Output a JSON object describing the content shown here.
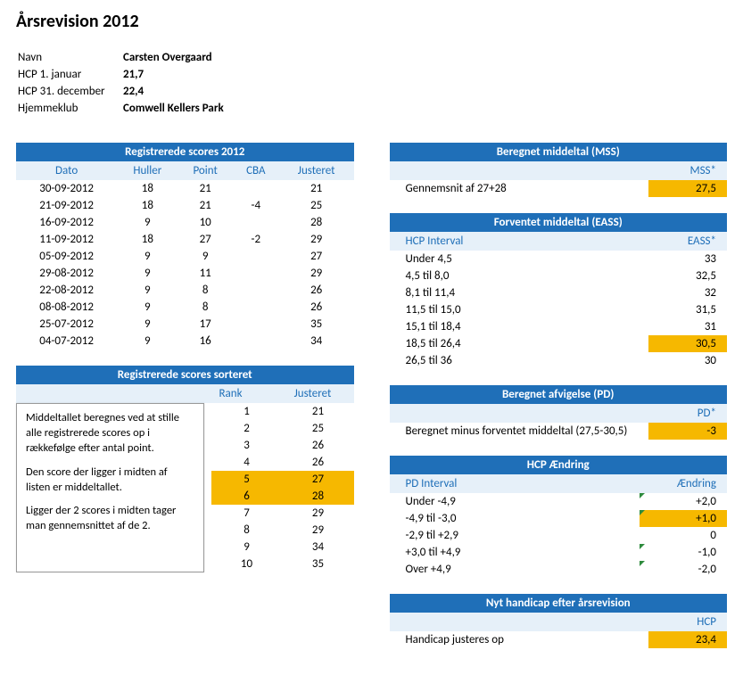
{
  "title": "Årsrevision 2012",
  "info": {
    "name_label": "Navn",
    "name": "Carsten Overgaard",
    "hcp_jan_label": "HCP 1. januar",
    "hcp_jan": "21,7",
    "hcp_dec_label": "HCP 31. december",
    "hcp_dec": "22,4",
    "club_label": "Hjemmeklub",
    "club": "Comwell Kellers Park"
  },
  "scores": {
    "title": "Registrerede scores 2012",
    "headers": {
      "date": "Dato",
      "holes": "Huller",
      "points": "Point",
      "cba": "CBA",
      "adjusted": "Justeret"
    },
    "rows": [
      {
        "date": "30-09-2012",
        "holes": "18",
        "points": "21",
        "cba": "",
        "adj": "21"
      },
      {
        "date": "21-09-2012",
        "holes": "18",
        "points": "21",
        "cba": "-4",
        "adj": "25"
      },
      {
        "date": "16-09-2012",
        "holes": "9",
        "points": "10",
        "cba": "",
        "adj": "28"
      },
      {
        "date": "11-09-2012",
        "holes": "18",
        "points": "27",
        "cba": "-2",
        "adj": "29"
      },
      {
        "date": "05-09-2012",
        "holes": "9",
        "points": "9",
        "cba": "",
        "adj": "27"
      },
      {
        "date": "29-08-2012",
        "holes": "9",
        "points": "11",
        "cba": "",
        "adj": "29"
      },
      {
        "date": "22-08-2012",
        "holes": "9",
        "points": "8",
        "cba": "",
        "adj": "26"
      },
      {
        "date": "08-08-2012",
        "holes": "9",
        "points": "8",
        "cba": "",
        "adj": "26"
      },
      {
        "date": "25-07-2012",
        "holes": "9",
        "points": "17",
        "cba": "",
        "adj": "35"
      },
      {
        "date": "04-07-2012",
        "holes": "9",
        "points": "16",
        "cba": "",
        "adj": "34"
      }
    ]
  },
  "sorted": {
    "title": "Registrerede scores sorteret",
    "headers": {
      "rank": "Rank",
      "adjusted": "Justeret"
    },
    "note_p1": "Middeltallet beregnes ved at stille alle registrerede scores op i rækkefølge efter antal point.",
    "note_p2": "Den score der ligger i midten af listen er middeltallet.",
    "note_p3": "Ligger der 2 scores i midten tager man gennemsnittet af de 2.",
    "rows": [
      {
        "rank": "1",
        "adj": "21",
        "hl": false
      },
      {
        "rank": "2",
        "adj": "25",
        "hl": false
      },
      {
        "rank": "3",
        "adj": "26",
        "hl": false
      },
      {
        "rank": "4",
        "adj": "26",
        "hl": false
      },
      {
        "rank": "5",
        "adj": "27",
        "hl": true
      },
      {
        "rank": "6",
        "adj": "28",
        "hl": true
      },
      {
        "rank": "7",
        "adj": "29",
        "hl": false
      },
      {
        "rank": "8",
        "adj": "29",
        "hl": false
      },
      {
        "rank": "9",
        "adj": "34",
        "hl": false
      },
      {
        "rank": "10",
        "adj": "35",
        "hl": false
      }
    ]
  },
  "mss": {
    "title": "Beregnet middeltal (MSS)",
    "col_label": "MSS*",
    "row_label": "Gennemsnit af 27+28",
    "value": "27,5"
  },
  "eass": {
    "title": "Forventet middeltal (EASS)",
    "col1": "HCP Interval",
    "col2": "EASS*",
    "rows": [
      {
        "range": "Under 4,5",
        "val": "33",
        "hl": false
      },
      {
        "range": "4,5 til 8,0",
        "val": "32,5",
        "hl": false
      },
      {
        "range": "8,1 til 11,4",
        "val": "32",
        "hl": false
      },
      {
        "range": "11,5 til 15,0",
        "val": "31,5",
        "hl": false
      },
      {
        "range": "15,1 til 18,4",
        "val": "31",
        "hl": false
      },
      {
        "range": "18,5 til 26,4",
        "val": "30,5",
        "hl": true
      },
      {
        "range": "26,5 til 36",
        "val": "30",
        "hl": false
      }
    ]
  },
  "pd": {
    "title": "Beregnet afvigelse (PD)",
    "col_label": "PD*",
    "row_label": "Beregnet minus forventet middeltal (27,5-30,5)",
    "value": "-3"
  },
  "change": {
    "title": "HCP Ændring",
    "col1": "PD Interval",
    "col2": "Ændring",
    "rows": [
      {
        "range": "Under -4,9",
        "val": "+2,0",
        "hl": false,
        "flag": true
      },
      {
        "range": "-4,9 til -3,0",
        "val": "+1,0",
        "hl": true,
        "flag": true
      },
      {
        "range": "-2,9 til +2,9",
        "val": "0",
        "hl": false,
        "flag": false
      },
      {
        "range": "+3,0 til +4,9",
        "val": "-1,0",
        "hl": false,
        "flag": true
      },
      {
        "range": "Over +4,9",
        "val": "-2,0",
        "hl": false,
        "flag": true
      }
    ]
  },
  "result": {
    "title": "Nyt handicap efter årsrevision",
    "col_label": "HCP",
    "row_label": "Handicap justeres op",
    "value": "23,4"
  }
}
